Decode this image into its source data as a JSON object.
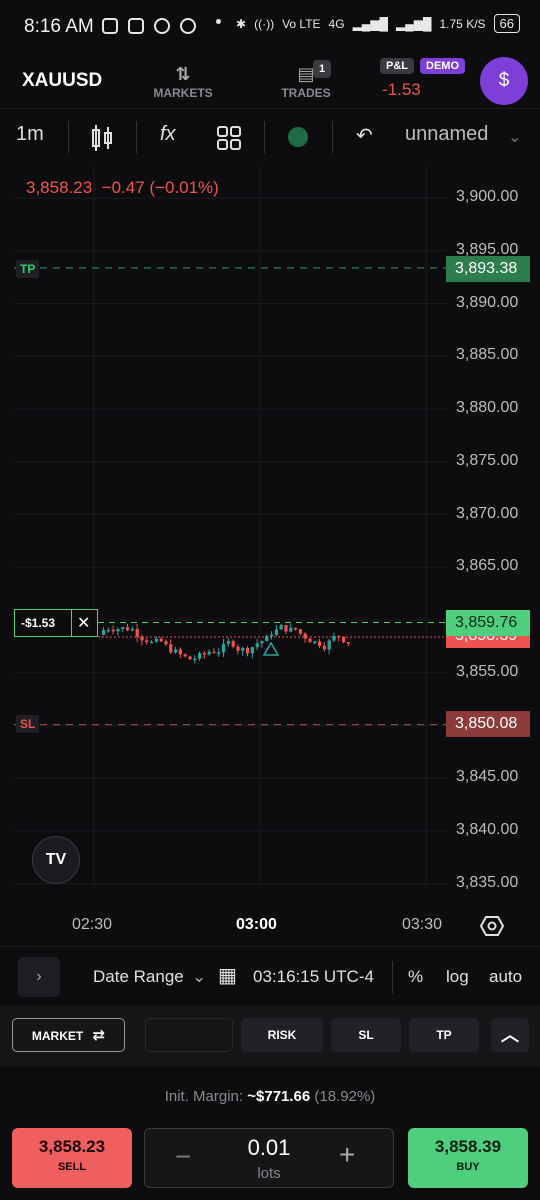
{
  "status_bar": {
    "time": "8:16 AM",
    "net_speed": "1.75 K/S",
    "network": "4G",
    "volte": "Vo LTE",
    "battery": "66"
  },
  "header": {
    "symbol": "XAUUSD",
    "markets_label": "MARKETS",
    "trades_label": "TRADES",
    "trades_badge": "1",
    "pnl_tag": "P&L",
    "demo_tag": "DEMO",
    "pnl_value": "-1.53",
    "avatar_symbol": "$"
  },
  "toolbar": {
    "timeframe": "1m",
    "layout_name": "unnamed",
    "indicators_glyph": "fx"
  },
  "chart": {
    "ohlc_price": "3,858.23",
    "ohlc_change": "−0.47 (−0.01%)",
    "y_ticks": [
      "3,900.00",
      "3,895.00",
      "3,890.00",
      "3,885.00",
      "3,880.00",
      "3,875.00",
      "3,870.00",
      "3,865.00",
      "3,860.00",
      "3,855.00",
      "3,850.00",
      "3,845.00",
      "3,840.00",
      "3,835.00"
    ],
    "x_ticks": [
      "02:30",
      "03:00",
      "03:30"
    ],
    "tp_label": "TP",
    "tp_price": "3,893.38",
    "sl_label": "SL",
    "sl_price": "3,850.08",
    "position_pnl": "-$1.53",
    "bid_price": "3,858.39",
    "ask_price": "3,859.76",
    "colors": {
      "up": "#26a69a",
      "down": "#ef5350",
      "tp": "#2e7d4f",
      "sl": "#8c3a3a"
    }
  },
  "bottom_bar": {
    "date_range": "Date Range",
    "time": "03:16:15 UTC-4",
    "percent": "%",
    "log": "log",
    "auto": "auto"
  },
  "controls": {
    "market": "MARKET",
    "risk": "RISK",
    "sl": "SL",
    "tp": "TP"
  },
  "order": {
    "margin_label": "Init. Margin:",
    "margin_value": "~$771.66",
    "margin_pct": "(18.92%)",
    "sell_price": "3,858.23",
    "sell_label": "SELL",
    "buy_price": "3,858.39",
    "buy_label": "BUY",
    "lots_value": "0.01",
    "lots_label": "lots"
  }
}
